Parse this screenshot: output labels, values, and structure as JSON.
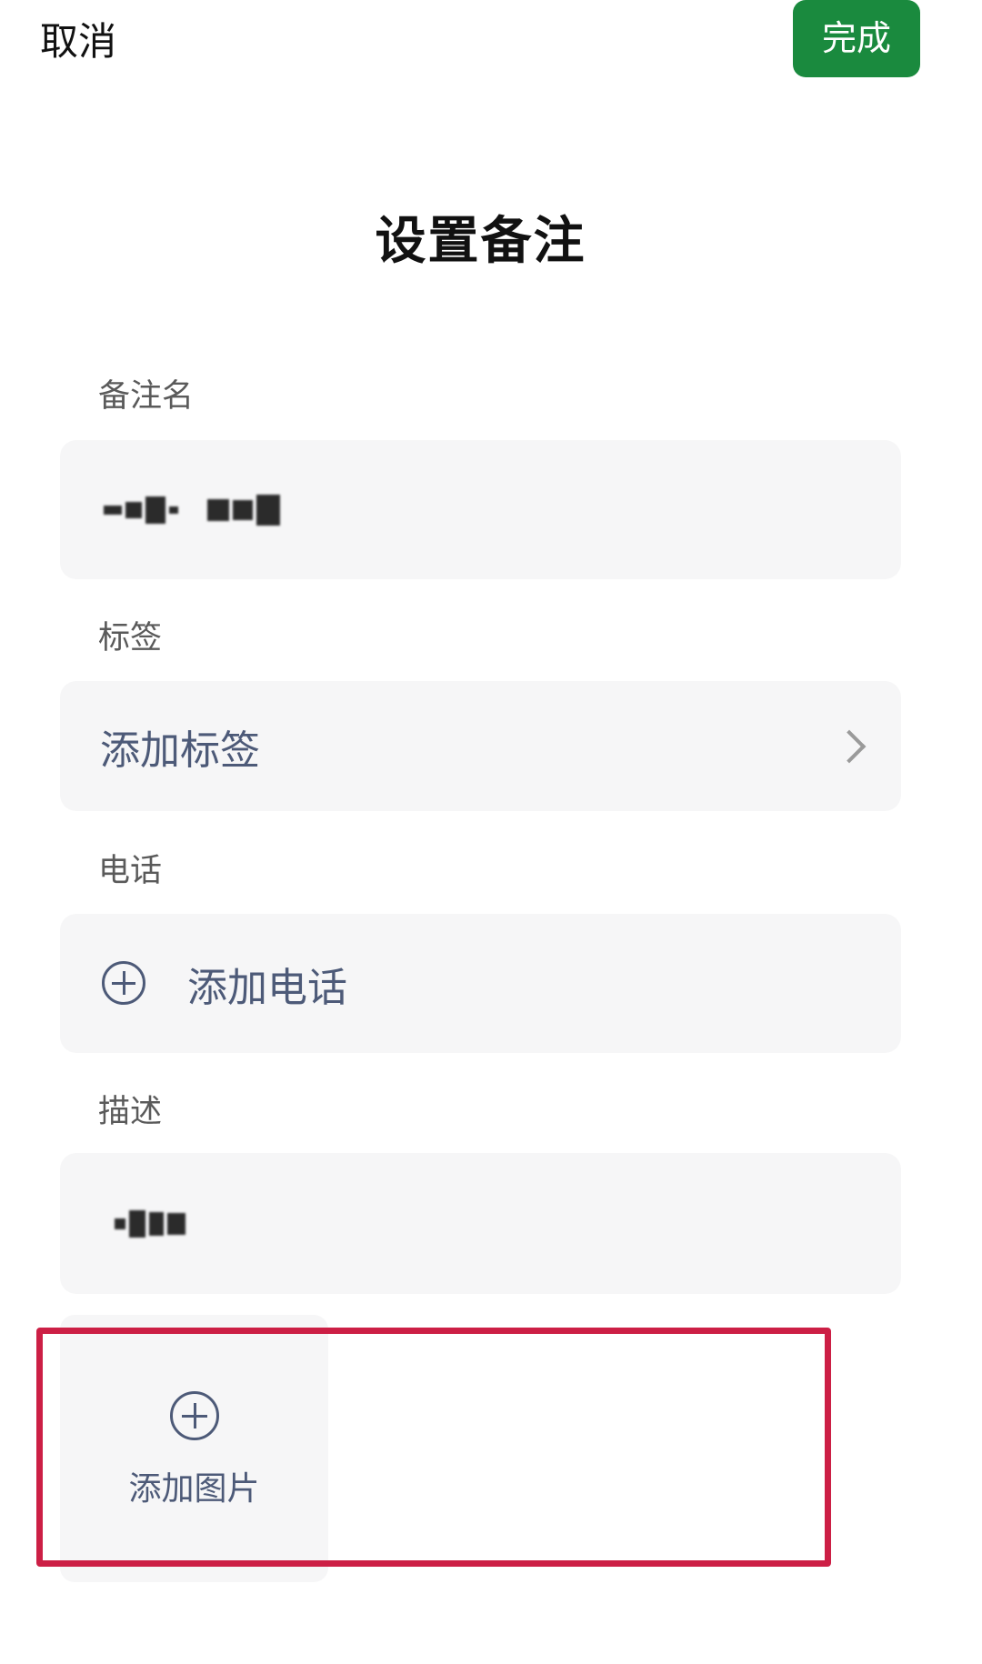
{
  "header": {
    "cancel_label": "取消",
    "done_label": "完成",
    "done_color": "#1a8a3e"
  },
  "page": {
    "title": "设置备注"
  },
  "remark": {
    "label": "备注名"
  },
  "tags": {
    "label": "标签",
    "action_label": "添加标签"
  },
  "phone": {
    "label": "电话",
    "action_label": "添加电话"
  },
  "description": {
    "label": "描述"
  },
  "images": {
    "action_label": "添加图片"
  },
  "icons": {
    "chevron": "chevron-right-icon",
    "add": "plus-circle-icon"
  },
  "annotation": {
    "highlight_color": "#cc1f45"
  }
}
